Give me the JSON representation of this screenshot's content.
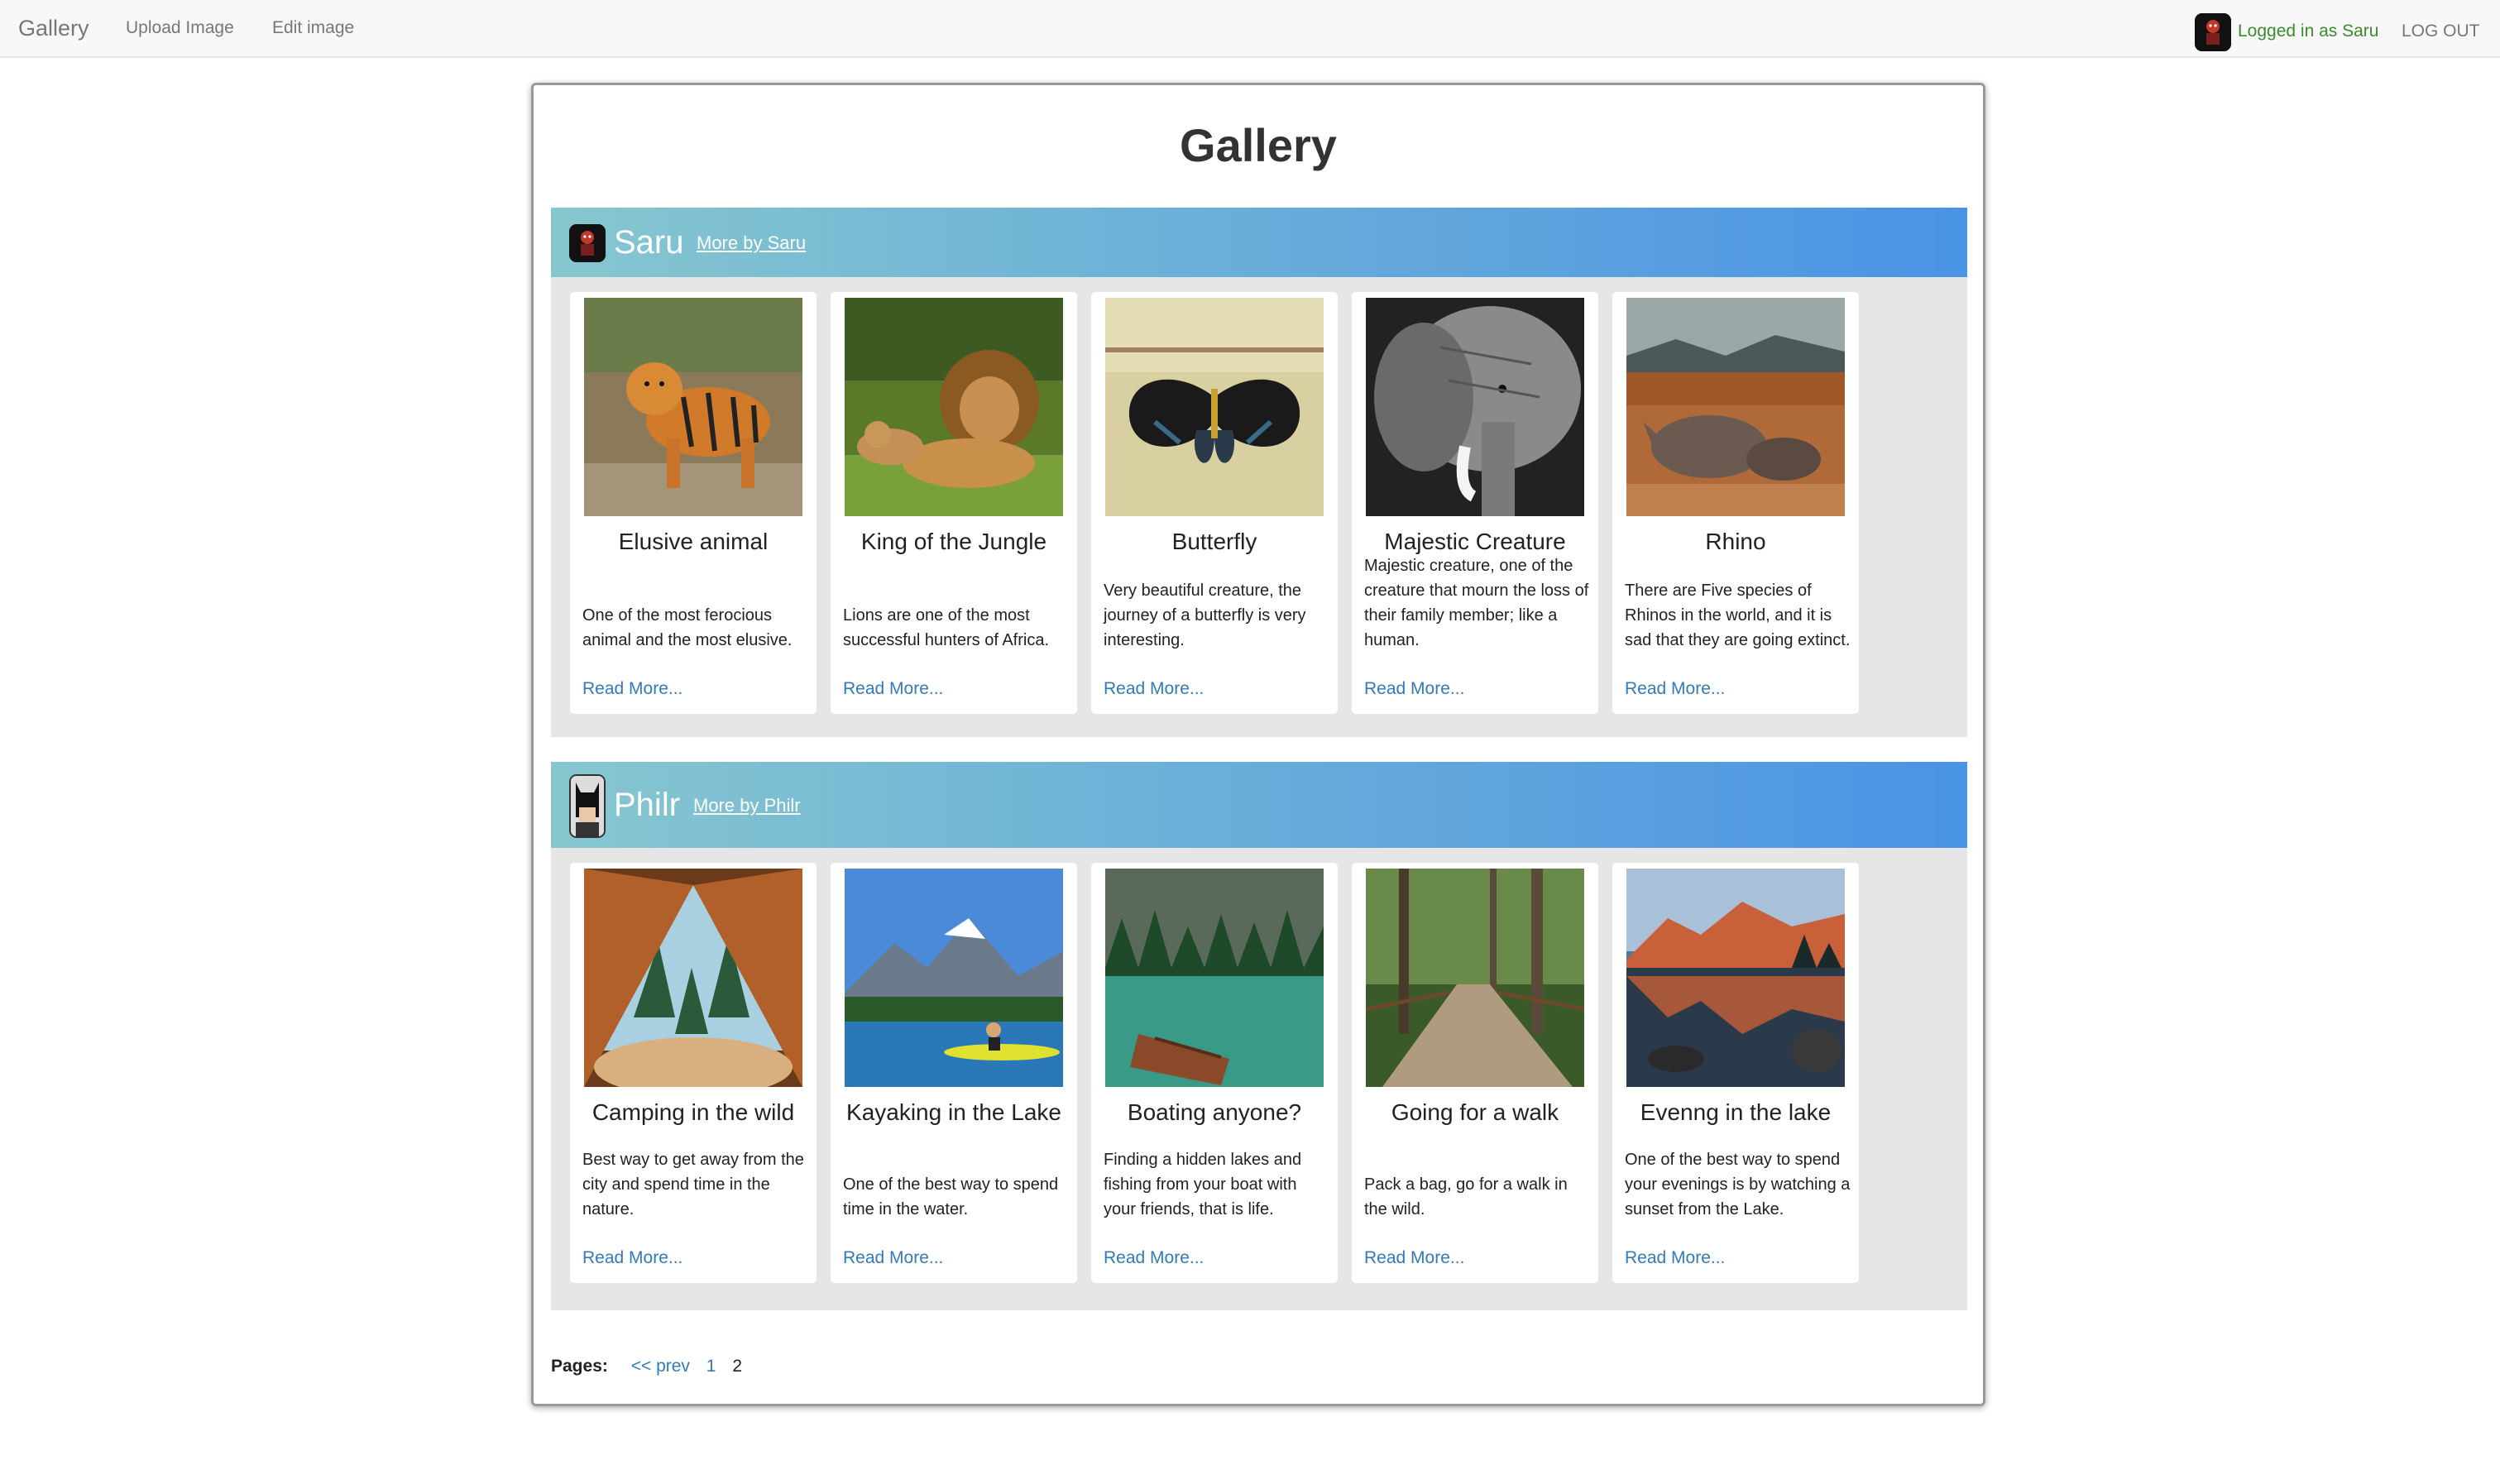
{
  "nav": {
    "brand": "Gallery",
    "upload": "Upload Image",
    "edit": "Edit image",
    "user": "Logged in as Saru",
    "logout": "LOG OUT"
  },
  "page": {
    "title": "Gallery"
  },
  "sections": [
    {
      "user": "Saru",
      "more": "More by Saru",
      "cards": [
        {
          "title": "Elusive animal",
          "desc": "One of the most ferocious animal and the most elusive.",
          "more": "Read More..."
        },
        {
          "title": "King of the Jungle",
          "desc": "Lions are one of the most successful hunters of Africa.",
          "more": "Read More..."
        },
        {
          "title": "Butterfly",
          "desc": "Very beautiful creature, the journey of a butterfly is very interesting.",
          "more": "Read More..."
        },
        {
          "title": "Majestic Creature",
          "desc": "Majestic creature, one of the creature that mourn the loss of their family member; like a human.",
          "more": "Read More..."
        },
        {
          "title": "Rhino",
          "desc": "There are Five species of Rhinos in the world, and it is sad that they are going extinct.",
          "more": "Read More..."
        }
      ]
    },
    {
      "user": "Philr",
      "more": "More by Philr",
      "cards": [
        {
          "title": "Camping in the wild",
          "desc": "Best way to get away from the city and spend time in the nature.",
          "more": "Read More..."
        },
        {
          "title": "Kayaking in the Lake",
          "desc": "One of the best way to spend time in the water.",
          "more": "Read More..."
        },
        {
          "title": "Boating anyone?",
          "desc": "Finding a hidden lakes and fishing from your boat with your friends, that is life.",
          "more": "Read More..."
        },
        {
          "title": "Going for a walk",
          "desc": "Pack a bag, go for a walk in the wild.",
          "more": "Read More..."
        },
        {
          "title": "Evenng in the lake",
          "desc": "One of the best way to spend your evenings is by watching a sunset from the Lake.",
          "more": "Read More..."
        }
      ]
    }
  ],
  "pagination": {
    "label": "Pages:",
    "prev": "<< prev",
    "p1": "1",
    "p2": "2"
  }
}
